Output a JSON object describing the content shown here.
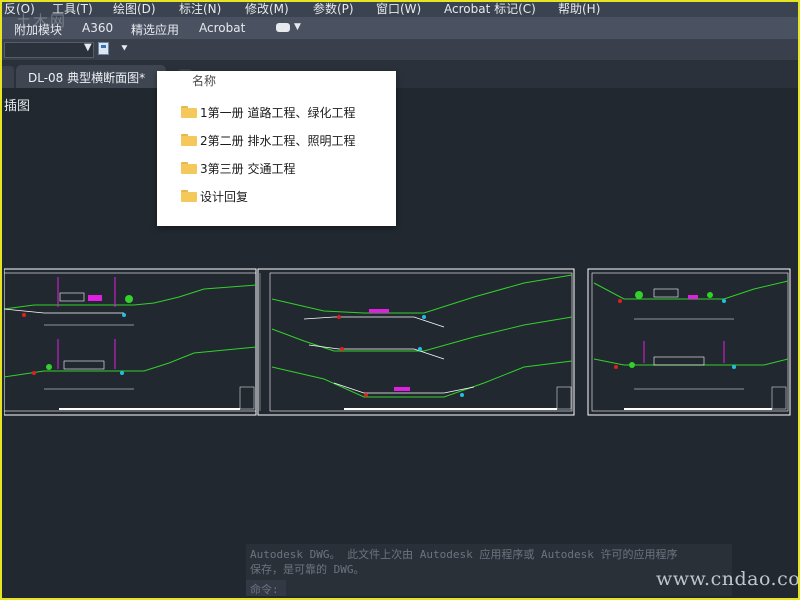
{
  "menu": {
    "items": [
      "反(O)",
      "工具(T)",
      "绘图(D)",
      "标注(N)",
      "修改(M)",
      "参数(P)",
      "窗口(W)",
      "Acrobat 标记(C)",
      "帮助(H)"
    ]
  },
  "ribbon": {
    "tabs": [
      "附加模块",
      "A360",
      "精选应用",
      "Acrobat"
    ]
  },
  "document": {
    "tab_title": "DL-08 典型横断面图*",
    "tab_close": "×",
    "canvas_label": "插图"
  },
  "popup": {
    "header": "名称",
    "folders": [
      {
        "name": "1第一册 道路工程、绿化工程"
      },
      {
        "name": "2第二册 排水工程、照明工程"
      },
      {
        "name": "3第三册 交通工程"
      },
      {
        "name": "设计回复"
      }
    ]
  },
  "command_line": {
    "line1": "Autodesk DWG。  此文件上次由 Autodesk 应用程序或 Autodesk 许可的应用程序",
    "line2": "保存，是可靠的 DWG。",
    "prompt": "命令:"
  },
  "watermarks": {
    "top": "土木网",
    "url": "www.cndao.com"
  },
  "colors": {
    "canvas": "#212830",
    "frame": "#e5e523",
    "drawing_line": "#ffffff",
    "ground_line": "#32d22a",
    "magenta": "#e020e0",
    "red": "#e02020",
    "cyan": "#20c0e0"
  }
}
